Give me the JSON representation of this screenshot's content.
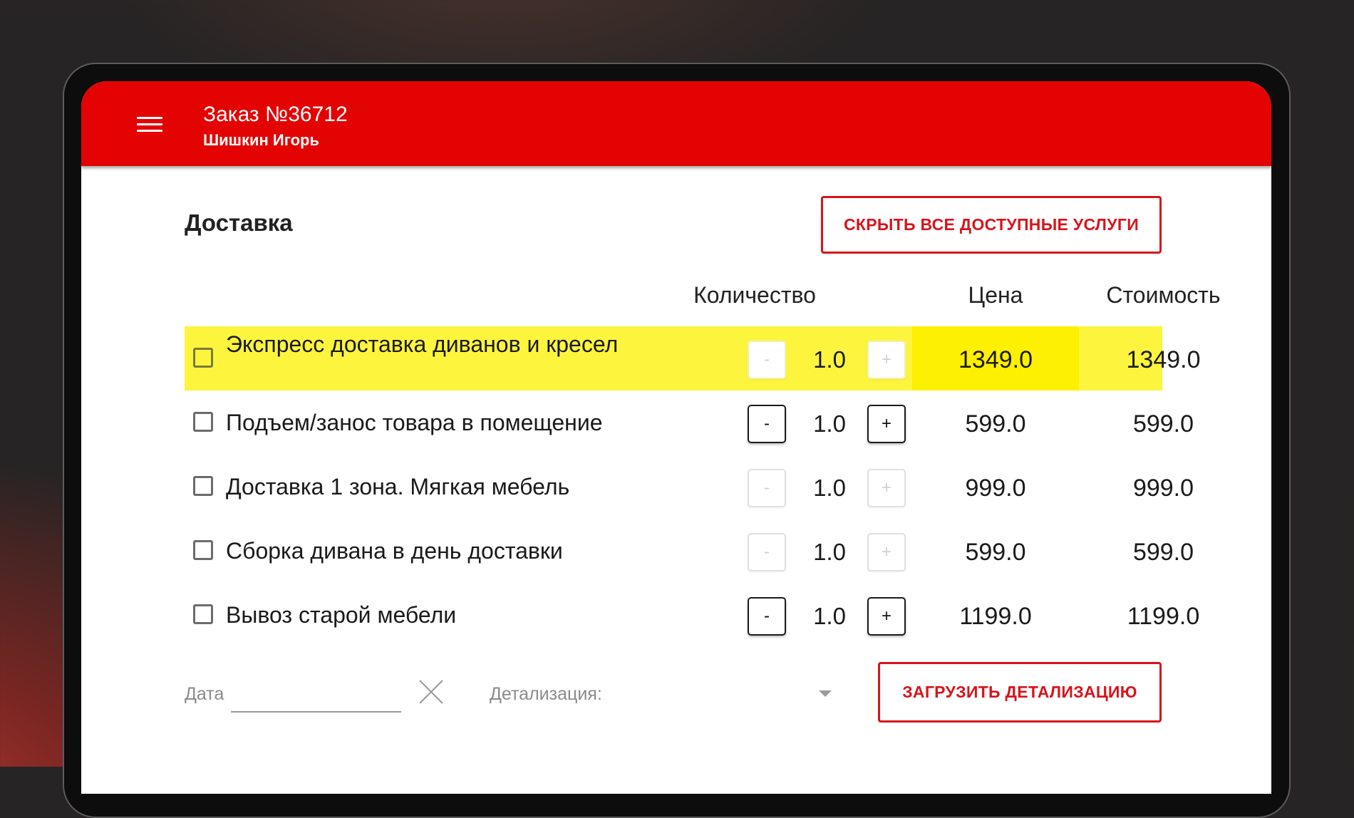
{
  "header": {
    "title": "Заказ №36712",
    "subtitle": "Шишкин Игорь"
  },
  "section": {
    "title": "Доставка",
    "hide_services_button": "СКРЫТЬ ВСЕ ДОСТУПНЫЕ УСЛУГИ"
  },
  "table": {
    "columns": {
      "quantity": "Количество",
      "price": "Цена",
      "cost": "Стоимость"
    },
    "rows": [
      {
        "name": "Экспресс доставка диванов и кресел",
        "qty": "1.0",
        "price": "1349.0",
        "cost": "1349.0",
        "minus": "-",
        "plus": "+",
        "highlighted": true
      },
      {
        "name": "Подъем/занос товара в помещение",
        "qty": "1.0",
        "price": "599.0",
        "cost": "599.0",
        "minus": "-",
        "plus": "+"
      },
      {
        "name": "Доставка 1 зона. Мягкая мебель",
        "qty": "1.0",
        "price": "999.0",
        "cost": "999.0",
        "minus": "-",
        "plus": "+"
      },
      {
        "name": "Сборка дивана в день доставки",
        "qty": "1.0",
        "price": "599.0",
        "cost": "599.0",
        "minus": "-",
        "plus": "+"
      },
      {
        "name": "Вывоз старой мебели",
        "qty": "1.0",
        "price": "1199.0",
        "cost": "1199.0",
        "minus": "-",
        "plus": "+"
      }
    ]
  },
  "footer": {
    "date_label": "Дата",
    "date_value": "",
    "detail_label": "Детализация:",
    "load_button": "ЗАГРУЗИТЬ ДЕТАЛИЗАЦИЮ"
  },
  "colors": {
    "brand_red": "#e30303",
    "highlight_yellow": "#fdf53d"
  },
  "icons": [
    "menu-icon",
    "close-icon",
    "dropdown-caret-icon",
    "checkbox-icon"
  ]
}
